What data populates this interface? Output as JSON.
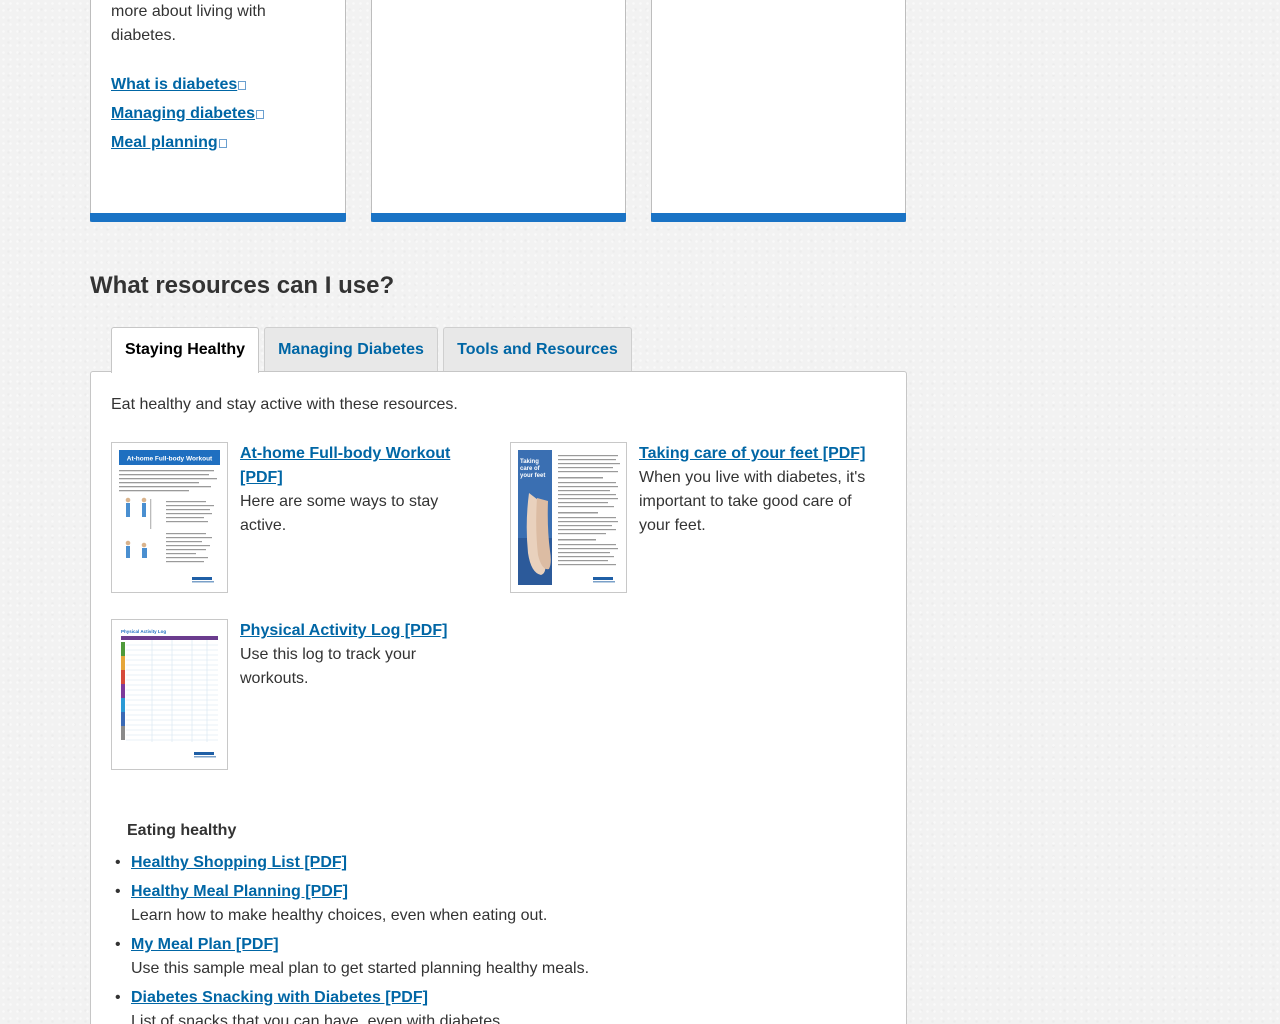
{
  "cards": {
    "card1": {
      "text": "more about living with diabetes.",
      "links": [
        {
          "label": "What is diabetes"
        },
        {
          "label": "Managing diabetes"
        },
        {
          "label": "Meal planning"
        }
      ]
    }
  },
  "section": {
    "heading": "What resources can I use?"
  },
  "tabs": [
    {
      "label": "Staying Healthy",
      "active": true
    },
    {
      "label": "Managing Diabetes",
      "active": false
    },
    {
      "label": "Tools and Resources",
      "active": false
    }
  ],
  "panel": {
    "intro": "Eat healthy and stay active with these resources.",
    "resources": [
      {
        "title": "At-home Full-body Workout [PDF]",
        "description": "Here are some ways to stay active.",
        "thumb_heading": "At-home Full-body Workout"
      },
      {
        "title": "Taking care of your feet [PDF]",
        "description": "When you live with diabetes, it's important to take good care of your feet.",
        "thumb_heading": "Taking care of your feet"
      },
      {
        "title": "Physical Activity Log [PDF]",
        "description": "Use this log to track your workouts.",
        "thumb_heading": "Physical Activity Log"
      }
    ],
    "eating": {
      "heading": "Eating healthy",
      "items": [
        {
          "link": "Healthy Shopping List [PDF]",
          "description": ""
        },
        {
          "link": "Healthy Meal Planning [PDF]",
          "description": "Learn how to make healthy choices, even when eating out."
        },
        {
          "link": "My Meal Plan [PDF]",
          "description": "Use this sample meal plan to get started planning healthy meals."
        },
        {
          "link": "Diabetes Snacking with Diabetes [PDF]",
          "description": "List of snacks that you can have, even with diabetes."
        }
      ]
    }
  },
  "colors": {
    "link": "#0066a5",
    "card_accent": "#1a73c5",
    "thumb_blue": "#1f6fc0",
    "thumb_feet": "#3a6fb2"
  },
  "icons": {
    "external_link": "external-link-icon"
  }
}
